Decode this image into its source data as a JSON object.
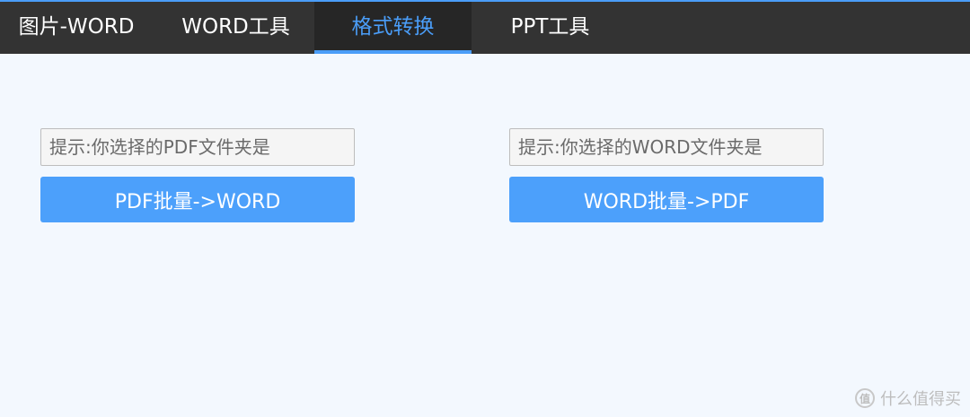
{
  "tabs": [
    {
      "label": "图片-WORD",
      "active": false
    },
    {
      "label": "WORD工具",
      "active": false
    },
    {
      "label": "格式转换",
      "active": true
    },
    {
      "label": "PPT工具",
      "active": false
    }
  ],
  "left_panel": {
    "input_placeholder": "提示:你选择的PDF文件夹是",
    "button_label": "PDF批量->WORD"
  },
  "right_panel": {
    "input_placeholder": "提示:你选择的WORD文件夹是",
    "button_label": "WORD批量->PDF"
  },
  "watermark": {
    "logo": "值",
    "text": "什么值得买"
  },
  "colors": {
    "accent": "#4a9df8",
    "tabbar_bg": "#333333",
    "active_tab_bg": "#262626",
    "page_bg": "#f3f8fe",
    "button_bg": "#4ca0fb"
  }
}
